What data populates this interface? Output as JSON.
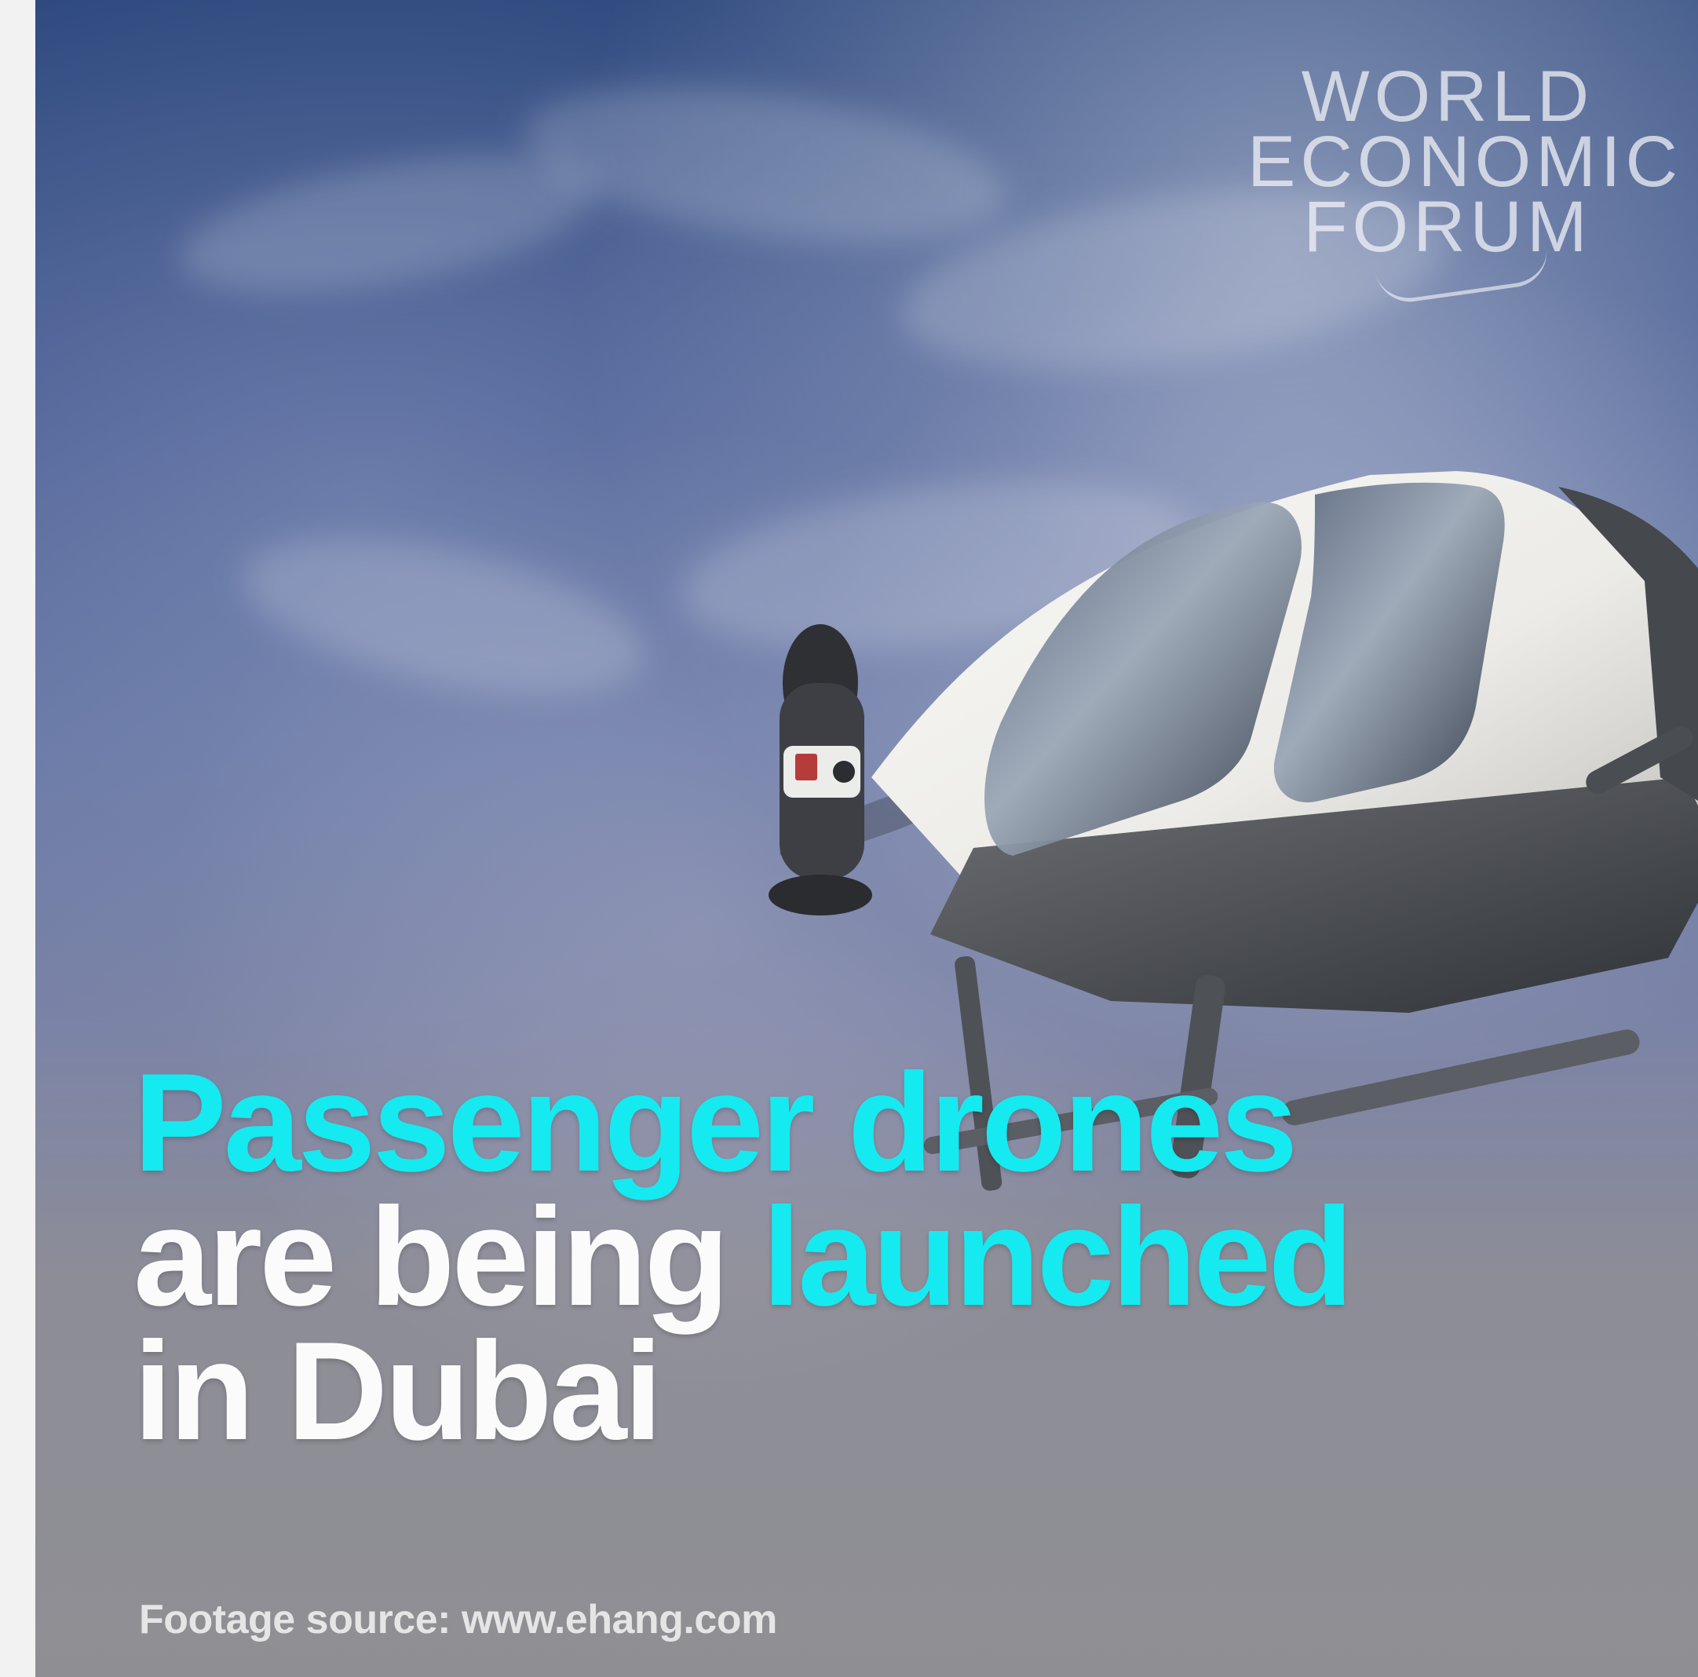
{
  "media": {
    "logo": {
      "lines": [
        "WORLD",
        "ECONOMIC",
        "FORUM"
      ]
    },
    "headline": {
      "line1": "Passenger drones",
      "line2_part1": "are being ",
      "line2_part2": "launched",
      "line3": "in Dubai"
    },
    "source_caption": "Footage source: www.ehang.com"
  },
  "colors": {
    "accent_cyan": "#15eaf1",
    "text_white": "#fbfbfb"
  },
  "icons": {
    "logo": "world-economic-forum-logo",
    "drone": "passenger-drone-image"
  }
}
